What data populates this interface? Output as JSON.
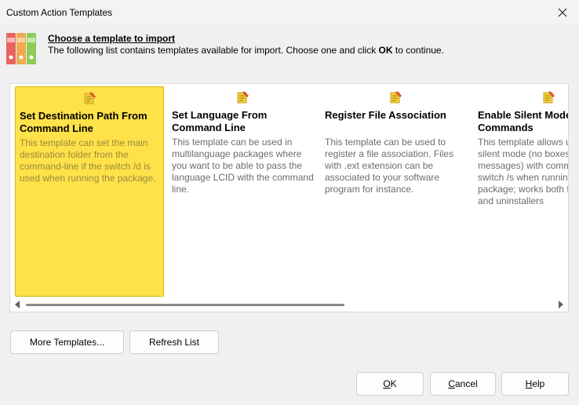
{
  "window": {
    "title": "Custom Action Templates"
  },
  "header": {
    "title": "Choose a template to import",
    "desc_before": "The following list contains templates available for import. Choose one and click ",
    "desc_bold": "OK",
    "desc_after": " to continue."
  },
  "templates": [
    {
      "title": "Set Destination Path From Command Line",
      "desc": "This template can set the main destination folder from the command-line if the switch /d is used when running the package.",
      "selected": true
    },
    {
      "title": "Set Language From Command Line",
      "desc": "This template can be used in multilanguage packages where you want to be able to pass the language LCID with the command line.",
      "selected": false
    },
    {
      "title": "Register File Association",
      "desc": "This template can be used to register a file association. Files with .ext extension can be associated to your software program for instance.",
      "selected": false
    },
    {
      "title": "Enable Silent Mode Package Commands",
      "desc": "This template allows use of the silent mode (no boxes, no messages) with command-line switch /s when running the package; works both for packages and uninstallers",
      "selected": false
    }
  ],
  "buttons": {
    "more_templates": "More Templates...",
    "refresh_list": "Refresh List",
    "ok_acc": "O",
    "ok_rest": "K",
    "cancel_acc": "C",
    "cancel_rest": "ancel",
    "help_acc": "H",
    "help_rest": "elp"
  },
  "icons": {
    "header": "binders-icon",
    "template": "notepad-pencil-icon",
    "close": "close-icon"
  }
}
